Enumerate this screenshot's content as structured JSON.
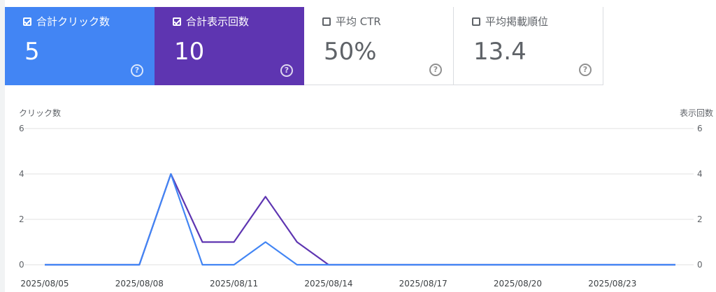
{
  "cards": [
    {
      "label": "合計クリック数",
      "value": "5",
      "checked": true,
      "bg": "#4285f4"
    },
    {
      "label": "合計表示回数",
      "value": "10",
      "checked": true,
      "bg": "#5e35b1"
    },
    {
      "label": "平均 CTR",
      "value": "50%",
      "checked": false,
      "bg": "#ffffff"
    },
    {
      "label": "平均掲載順位",
      "value": "13.4",
      "checked": false,
      "bg": "#ffffff"
    }
  ],
  "help_icon": "help-circle-icon",
  "chart_data": {
    "type": "line",
    "ylabel_left": "クリック数",
    "ylabel_right": "表示回数",
    "ylim_left": [
      0,
      6
    ],
    "ylim_right": [
      0,
      6
    ],
    "yticks": [
      "0",
      "2",
      "4",
      "6"
    ],
    "x": [
      "2025/08/05",
      "2025/08/06",
      "2025/08/07",
      "2025/08/08",
      "2025/08/09",
      "2025/08/10",
      "2025/08/11",
      "2025/08/12",
      "2025/08/13",
      "2025/08/14",
      "2025/08/15",
      "2025/08/16",
      "2025/08/17",
      "2025/08/18",
      "2025/08/19",
      "2025/08/20",
      "2025/08/21",
      "2025/08/22",
      "2025/08/23",
      "2025/08/24",
      "2025/08/25"
    ],
    "xtick_labels": [
      "2025/08/05",
      "2025/08/08",
      "2025/08/11",
      "2025/08/14",
      "2025/08/17",
      "2025/08/20",
      "2025/08/23"
    ],
    "grid": true,
    "series": [
      {
        "name": "合計表示回数",
        "axis": "right",
        "color": "#5e35b1",
        "values": [
          0,
          0,
          0,
          0,
          4,
          1,
          1,
          3,
          1,
          0,
          0,
          0,
          0,
          0,
          0,
          0,
          0,
          0,
          0,
          0,
          0
        ]
      },
      {
        "name": "合計クリック数",
        "axis": "left",
        "color": "#4285f4",
        "values": [
          0,
          0,
          0,
          0,
          4,
          0,
          0,
          1,
          0,
          0,
          0,
          0,
          0,
          0,
          0,
          0,
          0,
          0,
          0,
          0,
          0
        ]
      }
    ]
  }
}
